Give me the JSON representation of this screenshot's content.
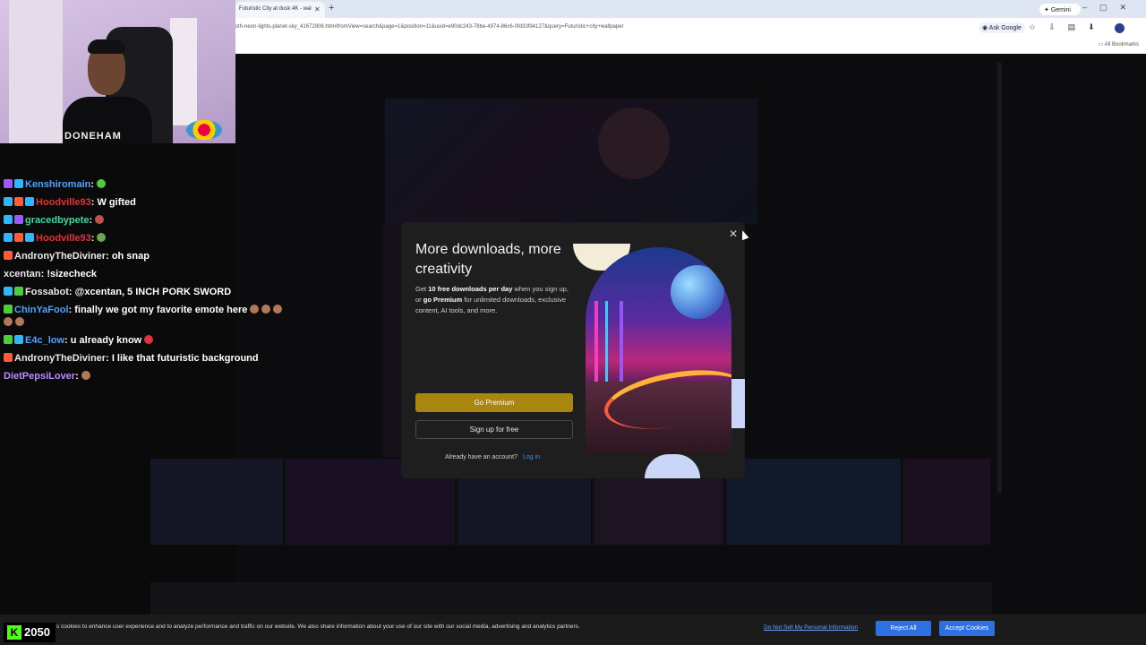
{
  "browser": {
    "tab_title": "Futuristic City at dusk 4K - wal",
    "url": "sth-neon-lights-planet-sky_41672806.htm#fromView=search&page=1&position=11&uuid=e90dc243-78be-4974-86c6-0fd33f94127&query=Futuristic+city+wallpaper",
    "gemini_label": "Gemini",
    "ask_google_label": "Ask Google",
    "bookmarks_label": "All Bookmarks"
  },
  "webcam": {
    "shirt_text": "DONEHAM"
  },
  "chat": {
    "messages": [
      {
        "user": "Kenshiromain",
        "color": "#4fa3ff",
        "text": ""
      },
      {
        "user": "Hoodville93",
        "color": "#e0323c",
        "text": "W gifted"
      },
      {
        "user": "gracedbypete",
        "color": "#3fd9a0",
        "text": ""
      },
      {
        "user": "Hoodville93",
        "color": "#e0323c",
        "text": ""
      },
      {
        "user": "AndronyTheDiviner",
        "color": "#e9e9e9",
        "text": "oh snap"
      },
      {
        "user": "xcentan",
        "color": "#e9e9e9",
        "text": "!sizecheck"
      },
      {
        "user": "Fossabot",
        "color": "#e9e9e9",
        "text": "@xcentan, 5 INCH PORK SWORD"
      },
      {
        "user": "ChinYaFool",
        "color": "#4fa3ff",
        "text": "finally we got my favorite emote here"
      },
      {
        "user": "E4c_low",
        "color": "#4fa3ff",
        "text": "u already know"
      },
      {
        "user": "AndronyTheDiviner",
        "color": "#e9e9e9",
        "text": "I like that futuristic background"
      },
      {
        "user": "DietPepsiLover",
        "color": "#b68cff",
        "text": ""
      }
    ]
  },
  "modal": {
    "title": "More downloads, more creativity",
    "desc_prefix": "Get ",
    "desc_bold1": "10 free downloads per day",
    "desc_mid": " when you sign up, or ",
    "desc_bold2": "go Premium",
    "desc_suffix": " for unlimited downloads, exclusive content, AI tools, and more.",
    "premium_label": "Go Premium",
    "signup_label": "Sign up for free",
    "account_prompt": "Already have an account?",
    "login_label": "Log in",
    "close_glyph": "✕"
  },
  "cookie_bar": {
    "text": "s cookies to enhance user experience and to analyze performance and traffic on our website. We also share information about your use of our site with our social media, advertising and analytics partners.",
    "do_not_sell": "Do Not Sell My Personal Information",
    "reject": "Reject All",
    "accept": "Accept Cookies"
  },
  "kick": {
    "logo": "K",
    "count": "2050"
  },
  "colors": {
    "premium": "#a9860f",
    "link": "#3d8df0",
    "cookie_button": "#2f6fe4",
    "kick_green": "#53fc18"
  }
}
